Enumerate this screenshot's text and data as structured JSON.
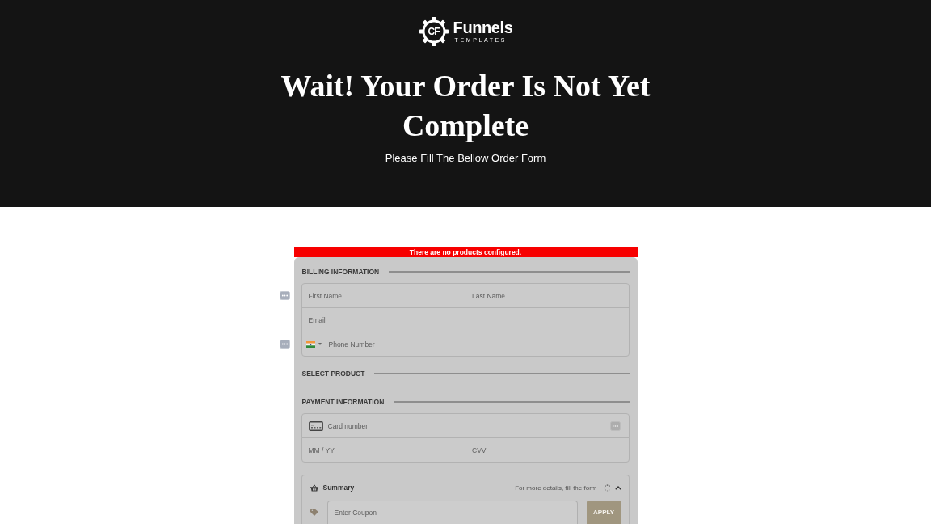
{
  "header": {
    "logo": {
      "monogram": "CF",
      "name": "Funnels",
      "tagline": "TEMPLATES"
    },
    "title": "Wait! Your Order Is Not Yet Complete",
    "subtitle": "Please Fill The Bellow Order Form"
  },
  "alert": "There are no products configured.",
  "billing": {
    "heading": "BILLING INFORMATION",
    "rows": [
      {
        "kind": "text",
        "autofill_icon": true,
        "fields": [
          {
            "placeholder": "First Name"
          },
          {
            "placeholder": "Last Name"
          }
        ]
      },
      {
        "kind": "text",
        "autofill_icon": false,
        "fields": [
          {
            "placeholder": "Email"
          }
        ]
      },
      {
        "kind": "phone",
        "autofill_icon": true,
        "fields": [
          {
            "placeholder": "Phone Number"
          }
        ]
      }
    ]
  },
  "select_product": {
    "heading": "SELECT PRODUCT"
  },
  "payment": {
    "heading": "PAYMENT INFORMATION",
    "card_number": {
      "placeholder": "Card number",
      "autofill_icon": true
    },
    "expiry": {
      "placeholder": "MM / YY"
    },
    "cvv": {
      "placeholder": "CVV"
    }
  },
  "summary": {
    "title": "Summary",
    "hint": "For more details, fill the form",
    "loading": true,
    "expanded": true,
    "coupon": {
      "placeholder": "Enter Coupon"
    },
    "apply_button": {
      "label": "APPLY",
      "disabled": true
    }
  }
}
